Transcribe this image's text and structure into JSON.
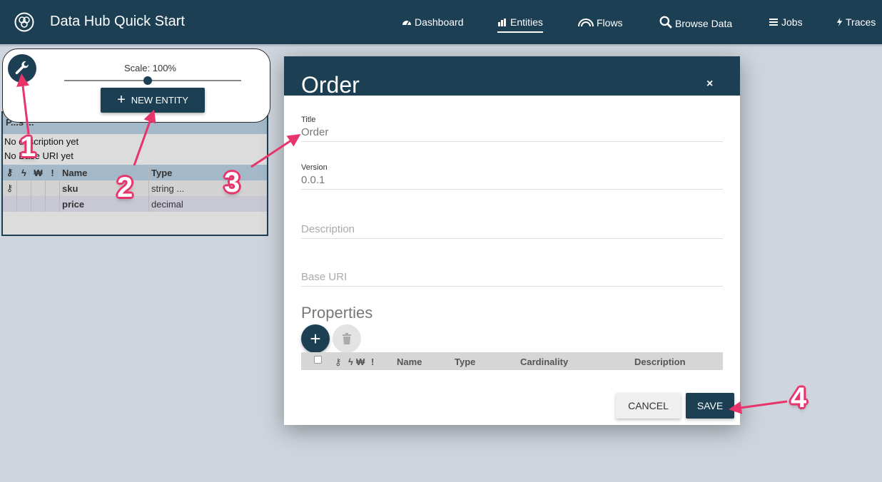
{
  "header": {
    "app_title": "Data Hub Quick Start",
    "nav": [
      {
        "label": "Dashboard",
        "icon": "dashboard-icon"
      },
      {
        "label": "Entities",
        "icon": "entities-icon",
        "active": true
      },
      {
        "label": "Flows",
        "icon": "flows-icon"
      },
      {
        "label": "Browse Data",
        "icon": "search-icon"
      },
      {
        "label": "Jobs",
        "icon": "jobs-icon"
      },
      {
        "label": "Traces",
        "icon": "traces-icon"
      }
    ]
  },
  "toolbar": {
    "scale_label": "Scale: 100%",
    "scale_value": 100,
    "new_entity_label": "NEW ENTITY"
  },
  "entity_card": {
    "header_text": "P...s ...",
    "description": "No description yet",
    "base_uri": "No Base URI yet",
    "columns": [
      "Name",
      "Type"
    ],
    "rows": [
      {
        "name": "sku",
        "type": "string ...",
        "primary_key": true
      },
      {
        "name": "price",
        "type": "decimal",
        "primary_key": false
      }
    ]
  },
  "modal": {
    "title": "Order",
    "close_symbol": "×",
    "fields": {
      "title_label": "Title",
      "title_value": "Order",
      "version_label": "Version",
      "version_value": "0.0.1",
      "description_placeholder": "Description",
      "base_uri_placeholder": "Base URI"
    },
    "properties_title": "Properties",
    "add_label": "+",
    "prop_columns": [
      "Name",
      "Type",
      "Cardinality",
      "Description"
    ],
    "cancel_label": "CANCEL",
    "save_label": "SAVE"
  },
  "annotations": [
    "1",
    "2",
    "3",
    "4"
  ],
  "colors": {
    "primary": "#1c3f53",
    "annotation": "#e8336b",
    "background": "#cfd5de"
  }
}
